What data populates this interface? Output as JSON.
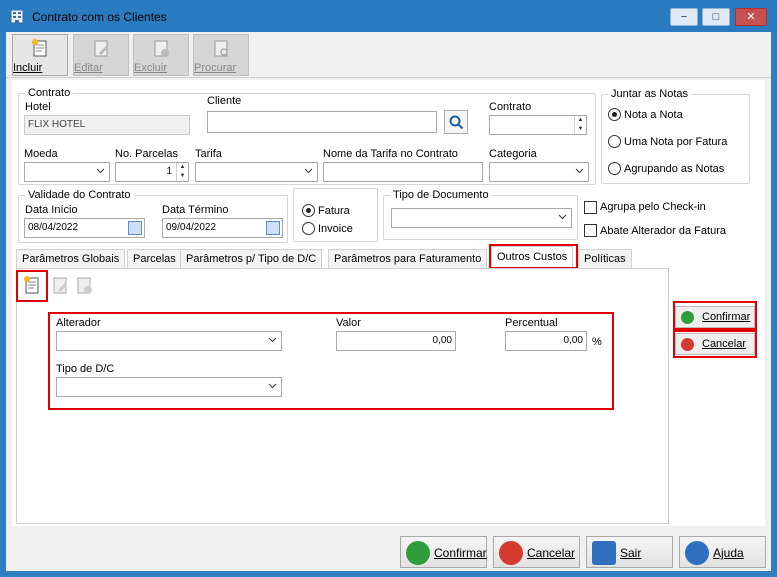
{
  "window": {
    "title": "Contrato com os Clientes",
    "controls": [
      "−",
      "□",
      "✕"
    ]
  },
  "toolbar": [
    {
      "label": "Incluir",
      "icon": "new-document-icon",
      "enabled": true
    },
    {
      "label": "Editar",
      "icon": "edit-document-icon",
      "enabled": false
    },
    {
      "label": "Excluir",
      "icon": "delete-document-icon",
      "enabled": false
    },
    {
      "label": "Procurar",
      "icon": "search-document-icon",
      "enabled": false
    }
  ],
  "contrato_group": {
    "title": "Contrato",
    "hotel_label": "Hotel",
    "hotel_value": "FLIX HOTEL",
    "cliente_label": "Cliente",
    "cliente_value": "",
    "contrato_label": "Contrato",
    "contrato_value": "",
    "moeda_label": "Moeda",
    "moeda_value": "",
    "parcelas_label": "No. Parcelas",
    "parcelas_value": "1",
    "tarifa_label": "Tarifa",
    "tarifa_value": "",
    "nome_tarifa_label": "Nome da Tarifa no Contrato",
    "nome_tarifa_value": "",
    "categoria_label": "Categoria",
    "categoria_value": ""
  },
  "juntar_notas": {
    "title": "Juntar as Notas",
    "options": [
      "Nota a Nota",
      "Uma Nota por Fatura",
      "Agrupando as Notas"
    ],
    "selected": 0
  },
  "validade": {
    "title": "Validade do Contrato",
    "inicio_label": "Data Início",
    "inicio_value": "08/04/2022",
    "termino_label": "Data Término",
    "termino_value": "09/04/2022"
  },
  "fatura_invoice": {
    "options": [
      "Fatura",
      "Invoice"
    ],
    "selected": 0
  },
  "tipo_documento": {
    "title": "Tipo de Documento",
    "value": ""
  },
  "checkboxes": [
    {
      "label": "Agrupa pelo Check-in",
      "checked": false
    },
    {
      "label": "Abate Alterador da Fatura",
      "checked": false
    }
  ],
  "tabs": [
    "Parâmetros Globais",
    "Parcelas",
    "Parâmetros p/ Tipo de D/C",
    "Parâmetros para Faturamento",
    "Outros Custos",
    "Políticas"
  ],
  "active_tab": 4,
  "outros_custos": {
    "alterador_label": "Alterador",
    "alterador_value": "",
    "valor_label": "Valor",
    "valor_value": "0,00",
    "percentual_label": "Percentual",
    "percentual_value": "0,00",
    "percent_sign": "%",
    "tipo_dc_label": "Tipo de D/C",
    "tipo_dc_value": ""
  },
  "side_buttons": {
    "confirmar": "Confirmar",
    "cancelar": "Cancelar"
  },
  "bottom_buttons": {
    "confirmar": "Confirmar",
    "cancelar": "Cancelar",
    "sair": "Sair",
    "ajuda": "Ajuda"
  },
  "colors": {
    "titlebar": "#2a7abf",
    "highlight": "#e00000",
    "confirm_green": "#2e9d3a",
    "cancel_red": "#d53a2f",
    "help_blue": "#2f6fc0"
  }
}
